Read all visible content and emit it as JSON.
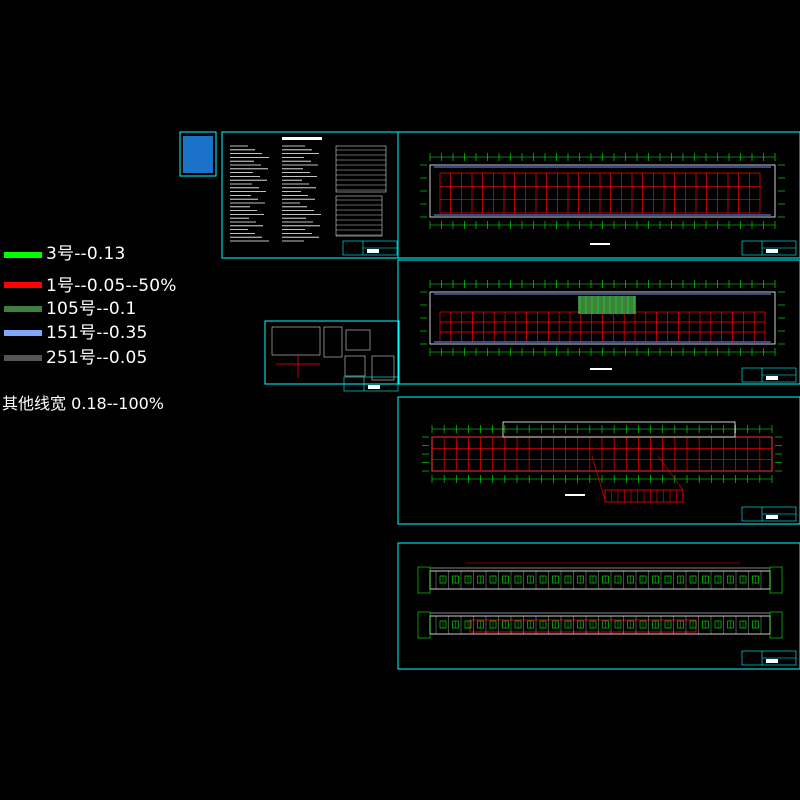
{
  "legend": {
    "items": [
      {
        "label": "3号--0.13",
        "color": "#00ff00"
      },
      {
        "label": "1号--0.05--50%",
        "color": "#ff0000"
      },
      {
        "label": "105号--0.1",
        "color": "#3f7f3f"
      },
      {
        "label": "151号--0.35",
        "color": "#7fa5ff"
      },
      {
        "label": "251号--0.05",
        "color": "#555555"
      }
    ],
    "other": "其他线宽  0.18--100%"
  },
  "colors": {
    "frame": "#00ffff",
    "grid": "#ff0000",
    "axis": "#00ff00",
    "text": "#ffffff",
    "blue": "#6f8fff"
  }
}
